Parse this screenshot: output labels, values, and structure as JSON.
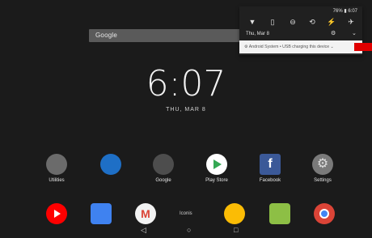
{
  "search": {
    "logo_text": "Google"
  },
  "lockscreen": {
    "time": "6:07",
    "date": "THU, MAR 8"
  },
  "apps": [
    {
      "label": "Utilities",
      "icon": "folder-icon",
      "color": "#6b6b6b"
    },
    {
      "label": "",
      "icon": "outlook-icon",
      "color": "#1e6fc6"
    },
    {
      "label": "Google",
      "icon": "google-folder-icon",
      "color": "#4d4d4d"
    },
    {
      "label": "Play Store",
      "icon": "play-store-icon",
      "color": "#ffffff"
    },
    {
      "label": "Facebook",
      "icon": "facebook-icon",
      "color": "#3b5998"
    },
    {
      "label": "Settings",
      "icon": "settings-gear-icon",
      "color": "#7a7a7a"
    }
  ],
  "dock": [
    {
      "icon": "youtube-icon",
      "color": "#ff0000"
    },
    {
      "icon": "calendar-icon",
      "color": "#3f82f0"
    },
    {
      "icon": "gmail-icon",
      "color": "#f2f2f2"
    },
    {
      "label": "Iconis"
    },
    {
      "icon": "photos-icon",
      "color": "#fbbc05"
    },
    {
      "icon": "camera-icon",
      "color": "#8dbf45"
    },
    {
      "icon": "chrome-icon",
      "color": "#db4437"
    }
  ],
  "nav": {
    "back": "◁",
    "home": "○",
    "recents": "□"
  },
  "shade": {
    "battery": "76% ▮ 6:07",
    "date": "Thu, Mar 8",
    "quick_settings": [
      "wifi-icon",
      "battery-saver-icon",
      "do-not-disturb-icon",
      "auto-rotate-icon",
      "flashlight-icon",
      "airplane-mode-icon"
    ],
    "notification": "⚙ Android System • USB charging this device ⌄"
  }
}
